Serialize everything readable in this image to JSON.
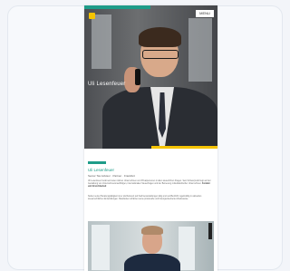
{
  "hero": {
    "title": "Uli Lesenfeuer",
    "menu_label": "MENU"
  },
  "colors": {
    "accent_teal": "#1e9c89",
    "accent_yellow": "#f5c400"
  },
  "section": {
    "title": "Uli Lesenfeuer",
    "subtitle": "Senior Tax Advisor · Partner · Frankfurt",
    "paragraph1": "Uli Lesenfeuer berät seit vielen Jahren Unternehmen und Privatpersonen in allen steuerlichen Fragen. Sein Schwerpunkt liegt auf der Gestaltung von Unternehmensnachfolgen, internationalen Steuerfragen und der Betreuung mittelständischer Unternehmen.",
    "paragraph1_bold": "Kontakt und Erreichbarkeit",
    "paragraph2": "Neben seiner Beratungstätigkeit ist er als Referent auf Fachveranstaltungen tätig und veröffentlicht regelmäßig zu aktuellen steuerrechtlichen Entwicklungen. Mandanten schätzen seine praxisnahe und lösungsorientierte Arbeitsweise."
  }
}
